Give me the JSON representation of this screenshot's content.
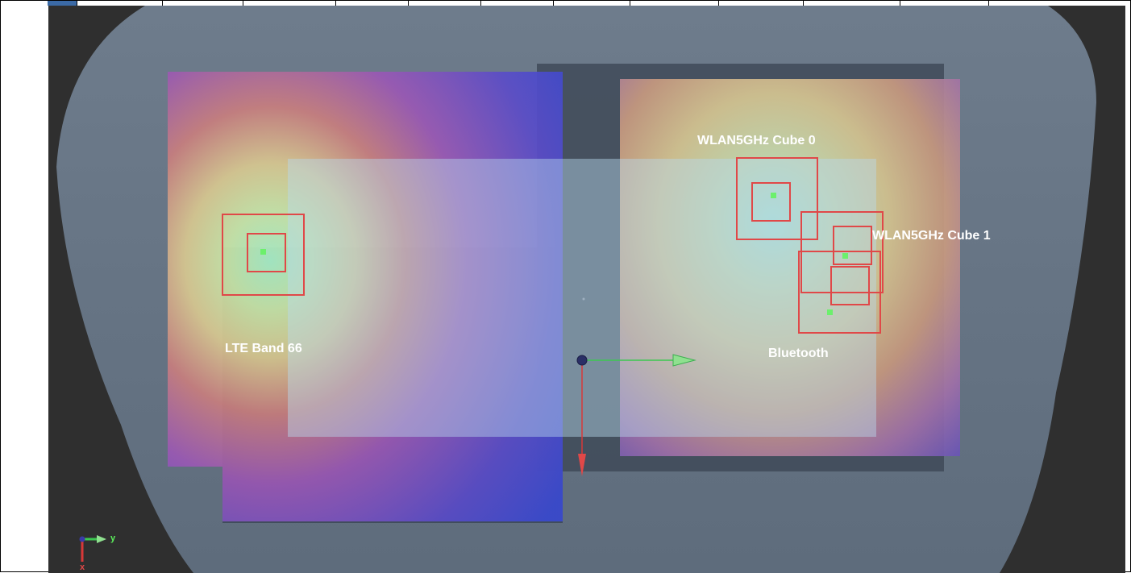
{
  "viewport": {
    "labels": {
      "lte": "LTE Band 66",
      "wlan0": "WLAN5GHz Cube 0",
      "wlan1": "WLAN5GHz Cube 1",
      "bluetooth": "Bluetooth"
    },
    "axis_triad": {
      "y_label": "y",
      "x_label": "x"
    }
  },
  "colors": {
    "background_dark": "#2e2e2e",
    "body_blob": "#6a7888",
    "left_heatmap_base": "#7a4fb0",
    "right_heatmap_base": "#b86a6a",
    "highlight_panel": "#b7d5ea",
    "red_boxes": "#e24a4a",
    "green_points": "#6cf06c"
  }
}
